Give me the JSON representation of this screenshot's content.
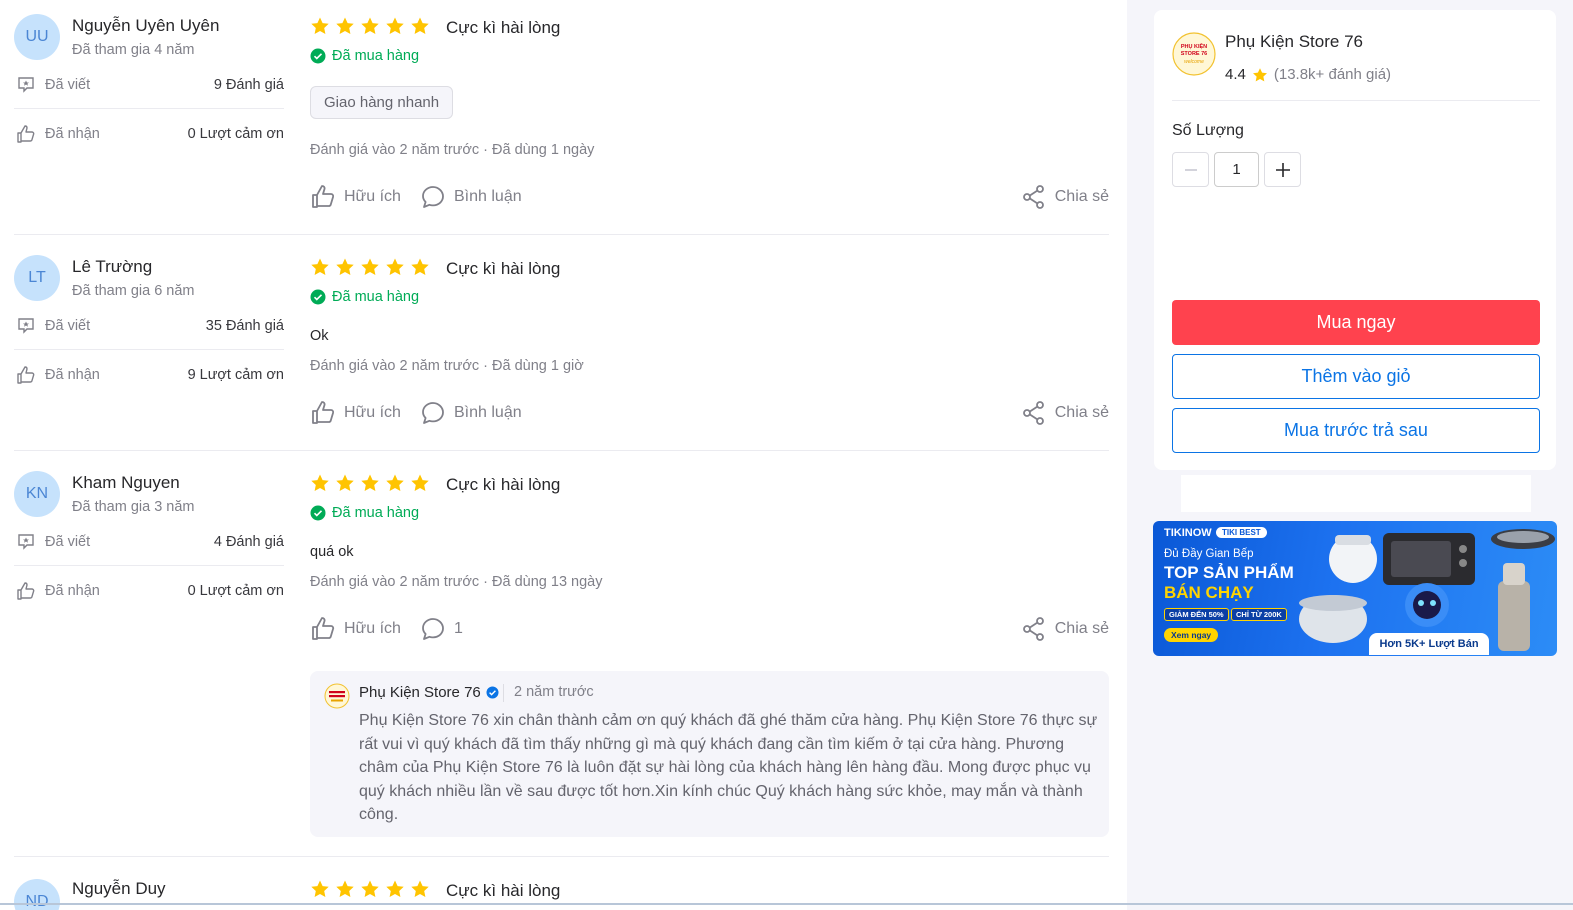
{
  "reviews": [
    {
      "initials": "UU",
      "name": "Nguyễn Uyên Uyên",
      "joined": "Đã tham gia 4 năm",
      "written_label": "Đã viết",
      "written_value": "9 Đánh giá",
      "received_label": "Đã nhận",
      "received_value": "0 Lượt cảm ơn",
      "stars": 5,
      "title": "Cực kì hài lòng",
      "bought": "Đã mua hàng",
      "chip": "Giao hàng nhanh",
      "meta": "Đánh giá vào 2 năm trước",
      "used": "Đã dùng 1 ngày",
      "helpful": "Hữu ích",
      "comment": "Bình luận",
      "share": "Chia sẻ"
    },
    {
      "initials": "LT",
      "name": "Lê Trường",
      "joined": "Đã tham gia 6 năm",
      "written_label": "Đã viết",
      "written_value": "35 Đánh giá",
      "received_label": "Đã nhận",
      "received_value": "9 Lượt cảm ơn",
      "stars": 5,
      "title": "Cực kì hài lòng",
      "bought": "Đã mua hàng",
      "text": "Ok",
      "meta": "Đánh giá vào 2 năm trước",
      "used": "Đã dùng 1 giờ",
      "helpful": "Hữu ích",
      "comment": "Bình luận",
      "share": "Chia sẻ"
    },
    {
      "initials": "KN",
      "name": "Kham Nguyen",
      "joined": "Đã tham gia 3 năm",
      "written_label": "Đã viết",
      "written_value": "4 Đánh giá",
      "received_label": "Đã nhận",
      "received_value": "0 Lượt cảm ơn",
      "stars": 5,
      "title": "Cực kì hài lòng",
      "bought": "Đã mua hàng",
      "text": "quá ok",
      "meta": "Đánh giá vào 2 năm trước",
      "used": "Đã dùng 13 ngày",
      "helpful": "Hữu ích",
      "comment": "1",
      "share": "Chia sẻ",
      "reply": {
        "store": "Phụ Kiện Store 76",
        "time": "2 năm trước",
        "text": "Phụ Kiện Store 76 xin chân thành cảm ơn quý khách đã ghé thăm cửa hàng. Phụ Kiện Store 76 thực sự rất vui vì quý khách đã tìm thấy những gì mà quý khách đang cần tìm kiếm ở tại cửa hàng. Phương châm của Phụ Kiện Store 76 là luôn đặt sự hài lòng của khách hàng lên hàng đầu. Mong được phục vụ quý khách nhiều lần về sau được tốt hơn.Xin kính chúc Quý khách hàng sức khỏe, may mắn và thành công."
      }
    },
    {
      "initials": "ND",
      "name": "Nguyễn Duy",
      "stars": 5,
      "title": "Cực kì hài lòng"
    }
  ],
  "store": {
    "logo_text": "PHỤ KIỆN STORE 76 welcome",
    "name": "Phụ Kiện Store 76",
    "rating": "4.4",
    "rating_count": "(13.8k+ đánh giá)"
  },
  "quantity": {
    "label": "Số Lượng",
    "value": "1"
  },
  "buttons": {
    "buy_now": "Mua ngay",
    "add_to_cart": "Thêm vào giỏ",
    "bnpl": "Mua trước trả sau"
  },
  "banner": {
    "brand": "TIKINOW",
    "badge": "TIKI BEST",
    "line1": "Đủ Đầy Gian Bếp",
    "line2": "TOP SẢN PHẨM",
    "line3": "BÁN CHẠY",
    "promo1": "GIẢM ĐẾN 50%",
    "promo2": "CHỈ TỪ 200K",
    "cta": "Xem ngay",
    "sold": "Hơn 5K+ Lượt Bán"
  },
  "colors": {
    "star": "#ffc400",
    "buy": "#ff424e",
    "primary": "#0b74e5",
    "bought": "#00ab56",
    "avatar_bg": "#c6e2fc"
  }
}
